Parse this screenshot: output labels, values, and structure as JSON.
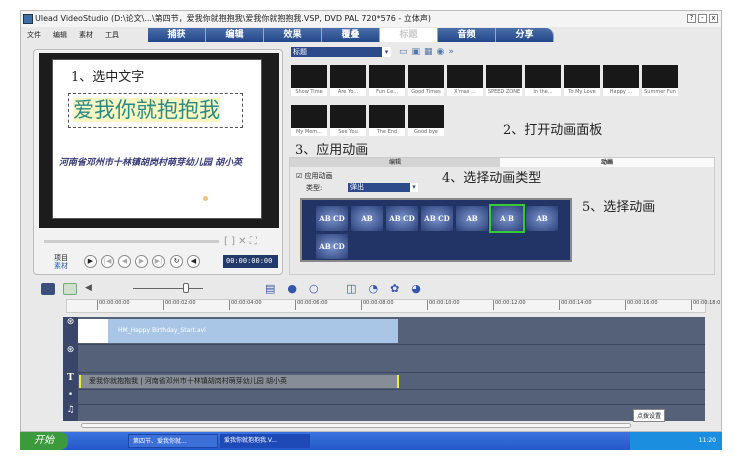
{
  "window": {
    "title": "Ulead VideoStudio (D:\\论文\\...\\第四节，爱我你就抱抱我\\爱我你就抱抱我.VSP, DVD PAL 720*576 - 立体声)",
    "buttons": [
      "?",
      "-",
      "x"
    ]
  },
  "menu": [
    "文件",
    "编辑",
    "素材",
    "工具"
  ],
  "tabs": [
    "捕获",
    "编辑",
    "效果",
    "覆叠",
    "标题",
    "音频",
    "分享"
  ],
  "active_tab": "标题",
  "preview": {
    "main_text": "爱我你就抱抱我",
    "sub_text": "河南省邓州市十林镇胡岗村萌芽幼儿园 胡小英",
    "mode_project": "项目",
    "mode_clip": "素材",
    "timecode": "00:00:00:00"
  },
  "annotations": {
    "a1": "1、选中文字",
    "a2": "2、打开动画面板",
    "a3": "3、应用动画",
    "a4": "4、选择动画类型",
    "a5": "5、选择动画"
  },
  "library": {
    "category": "标题",
    "thumbs": [
      "Show Time",
      "Are Yo...",
      "Fun Ce...",
      "Good Times",
      "X'mas ...",
      "SPEED ZONE",
      "In the...",
      "To My Love",
      "Happy ...",
      "Summer Fun",
      "My Mem...",
      "See You",
      "The End",
      "Good bye"
    ]
  },
  "options": {
    "tab_edit": "编辑",
    "tab_anim": "动画",
    "apply_label": "应用动画",
    "apply_checked": true,
    "type_label": "类型:",
    "type_value": "弹出",
    "animations": [
      "AB CD",
      "AB",
      "AB CD",
      "AB CD",
      "AB",
      "A B",
      "AB",
      "AB CD"
    ],
    "selected_index": 5
  },
  "timeline": {
    "ruler": [
      "00:00:00:00",
      "00:00:02:00",
      "00:00:04:00",
      "00:00:06:00",
      "00:00:08:00",
      "00:00:10:00",
      "00:00:12:00",
      "00:00:14:00",
      "00:00:16:00",
      "00:00:18:0"
    ],
    "video_clip": "HM_Happy Birthday_Start.avi",
    "title_clip": "爱我你就抱抱我 | 河南省邓州市十林镇胡岗村萌芽幼儿园  胡小英",
    "tooltip": "点拨设置"
  },
  "taskbar": {
    "start": "开始",
    "items": [
      "第四节、爱我你就...",
      "爱我你就抱抱我.V..."
    ],
    "clock": "11:20"
  }
}
